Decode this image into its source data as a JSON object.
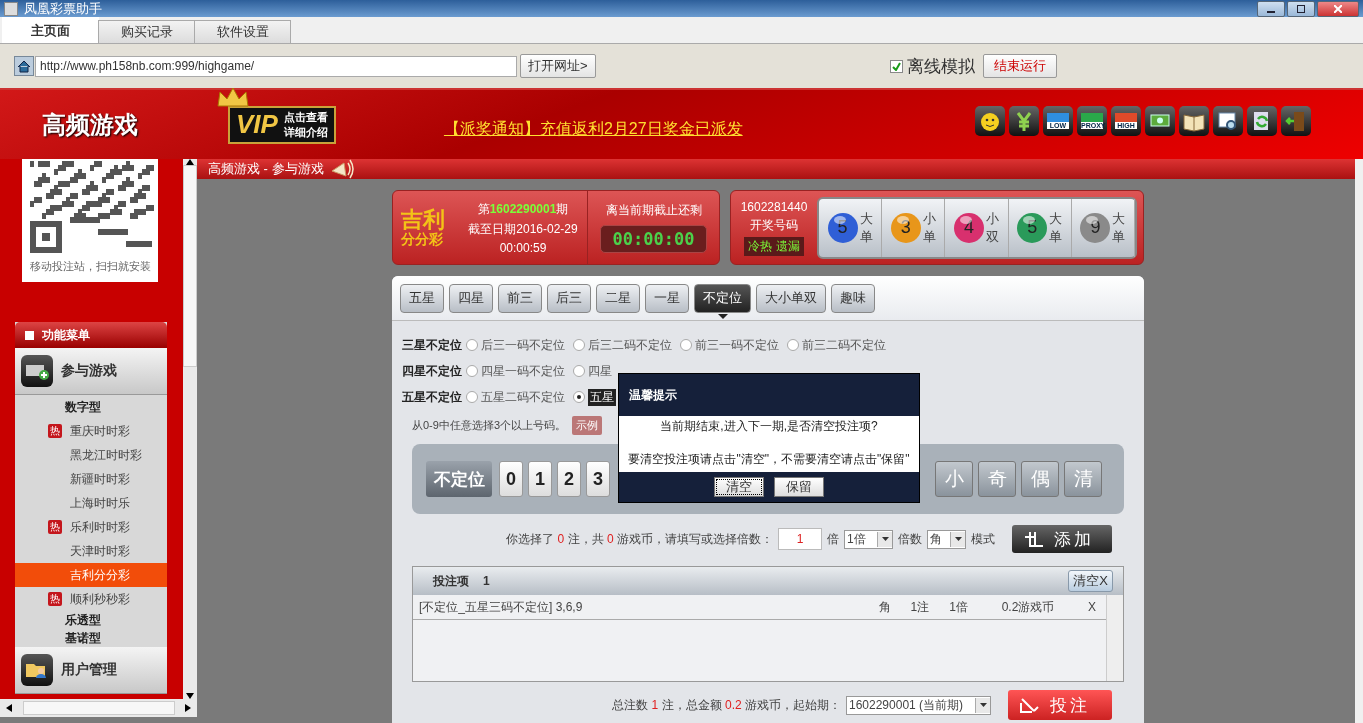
{
  "window": {
    "title": "凤凰彩票助手"
  },
  "tabs": [
    {
      "label": "主页面",
      "selected": true
    },
    {
      "label": "购买记录",
      "selected": false
    },
    {
      "label": "软件设置",
      "selected": false
    }
  ],
  "address": {
    "value": "http://www.ph158nb.com:999/highgame/",
    "open_button": "打开网址>"
  },
  "offline": {
    "label": "离线模拟",
    "checked": true
  },
  "stop_button": "结束运行",
  "banner": {
    "title": "高频游戏",
    "vip": "VIP",
    "vip_lines": [
      "点击查看",
      "详细介绍"
    ],
    "notice": "【派奖通知】充值返利2月27日奖金已派发"
  },
  "toolbar": [
    {
      "kind": "face"
    },
    {
      "kind": "yen"
    },
    {
      "kind": "label",
      "label": "LOW",
      "color": "#2f8fe0"
    },
    {
      "kind": "label",
      "label": "PROXY",
      "color": "#2aa84a"
    },
    {
      "kind": "label",
      "label": "HIGH",
      "color": "#e04a2a"
    },
    {
      "kind": "money"
    },
    {
      "kind": "book"
    },
    {
      "kind": "search"
    },
    {
      "kind": "refresh"
    },
    {
      "kind": "door"
    }
  ],
  "sidebar": {
    "qr_caption": "移动投注站，扫扫就安装",
    "menu_title": "功能菜单",
    "sections": [
      {
        "title": "参与游戏",
        "groups": [
          {
            "title": "数字型",
            "children": [
              {
                "label": "重庆时时彩",
                "badge": "热",
                "selected": false
              },
              {
                "label": "黑龙江时时彩",
                "selected": false
              },
              {
                "label": "新疆时时彩",
                "selected": false
              },
              {
                "label": "上海时时乐",
                "selected": false
              },
              {
                "label": "乐利时时彩",
                "badge": "热",
                "selected": false
              },
              {
                "label": "天津时时彩",
                "selected": false
              },
              {
                "label": "吉利分分彩",
                "selected": true
              },
              {
                "label": "顺利秒秒彩",
                "badge": "热",
                "selected": false
              }
            ]
          },
          {
            "title": "乐透型"
          },
          {
            "title": "基诺型"
          }
        ]
      },
      {
        "title": "用户管理"
      }
    ]
  },
  "breadcrumb": "高频游戏 - 参与游戏",
  "game": {
    "logo_top": "吉利",
    "logo_bottom": "分分彩",
    "period_prefix": "第",
    "period": "1602290001",
    "period_suffix": "期",
    "deadline": "截至日期2016-02-29",
    "deadline_time": "00:00:59",
    "countdown_label": "离当前期截止还剩",
    "countdown": "00:00:00"
  },
  "last_draw": {
    "period": "1602281440",
    "label": "开奖号码",
    "hot_cold": "冷热",
    "missing": "遗漏",
    "balls": [
      {
        "number": "5",
        "color": "#2f5fd6",
        "tags": [
          "大",
          "单"
        ]
      },
      {
        "number": "3",
        "color": "#e8961a",
        "tags": [
          "小",
          "单"
        ]
      },
      {
        "number": "4",
        "color": "#d8306e",
        "tags": [
          "小",
          "双"
        ]
      },
      {
        "number": "5",
        "color": "#2a9a5a",
        "tags": [
          "大",
          "单"
        ]
      },
      {
        "number": "9",
        "color": "#8a8a8a",
        "tags": [
          "大",
          "单"
        ]
      }
    ]
  },
  "play_tabs": [
    {
      "label": "五星",
      "selected": false
    },
    {
      "label": "四星",
      "selected": false
    },
    {
      "label": "前三",
      "selected": false
    },
    {
      "label": "后三",
      "selected": false
    },
    {
      "label": "二星",
      "selected": false
    },
    {
      "label": "一星",
      "selected": false
    },
    {
      "label": "不定位",
      "selected": true
    },
    {
      "label": "大小单双",
      "selected": false
    },
    {
      "label": "趣味",
      "selected": false
    }
  ],
  "options": [
    {
      "group": "三星不定位",
      "items": [
        {
          "label": "后三一码不定位",
          "selected": false
        },
        {
          "label": "后三二码不定位",
          "selected": false
        },
        {
          "label": "前三一码不定位",
          "selected": false
        },
        {
          "label": "前三二码不定位",
          "selected": false
        }
      ]
    },
    {
      "group": "四星不定位",
      "items": [
        {
          "label": "四星一码不定位",
          "selected": false
        },
        {
          "label": "四星",
          "selected": false
        }
      ]
    },
    {
      "group": "五星不定位",
      "items": [
        {
          "label": "五星二码不定位",
          "selected": false
        },
        {
          "label": "五星",
          "selected": true
        }
      ]
    }
  ],
  "hint": "从0-9中任意选择3个以上号码。",
  "example_button": "示例",
  "keypad": {
    "label": "不定位",
    "digits": [
      "0",
      "1",
      "2",
      "3"
    ],
    "shortcuts": [
      "小",
      "奇",
      "偶",
      "清"
    ]
  },
  "selection": {
    "text1": "你选择了",
    "bets": "0",
    "text2": "注，共",
    "coins": "0",
    "text3": "游戏币，请填写或选择倍数：",
    "multiple": "1",
    "multiple_unit": "倍",
    "multiple_select": "1倍",
    "multiple_label": "倍数",
    "mode_select": "角",
    "mode_label": "模式",
    "add_button": "添加"
  },
  "bet_list": {
    "title": "投注项",
    "count": "1",
    "clear_button": "清空X",
    "rows": [
      {
        "description": "[不定位_五星三码不定位] 3,6,9",
        "unit": "角",
        "bets": "1注",
        "multiple": "1倍",
        "amount": "0.2游戏币",
        "remove": "X"
      }
    ]
  },
  "footer": {
    "text1": "总注数",
    "bets": "1",
    "text2": "注，总金额",
    "amount": "0.2",
    "text3": "游戏币，起始期：",
    "period_select": "1602290001 (当前期)",
    "submit_button": "投注"
  },
  "dialog": {
    "title": "温馨提示",
    "lines": [
      "当前期结束,进入下一期,是否清空投注项?",
      "要清空投注项请点击\"清空\"，不需要清空请点击\"保留\""
    ],
    "buttons": [
      {
        "label": "清空",
        "focused": true
      },
      {
        "label": "保留",
        "focused": false
      }
    ]
  }
}
